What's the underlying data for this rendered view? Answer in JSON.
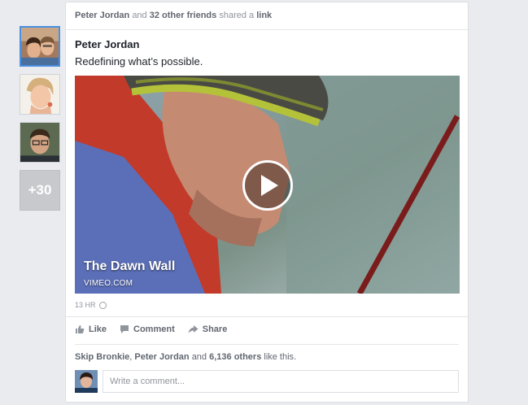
{
  "sidebar": {
    "more_count": "+30"
  },
  "story": {
    "header": {
      "actor": "Peter Jordan",
      "conj": "and",
      "friends": "32 other friends",
      "verb": "shared a",
      "object": "link"
    },
    "author": "Peter Jordan",
    "message": "Redefining what’s possible.",
    "video": {
      "title": "The Dawn Wall",
      "source": "VIMEO.COM"
    },
    "timestamp": "13 HR",
    "actions": {
      "like": "Like",
      "comment": "Comment",
      "share": "Share"
    },
    "likes": {
      "name1": "Skip Bronkie",
      "sep": ",",
      "name2": "Peter Jordan",
      "conj": "and",
      "others": "6,136 others",
      "tail": "like this."
    },
    "comment_placeholder": "Write a comment..."
  },
  "colors": {
    "accent": "#4a90e2",
    "background": "#e9ebee",
    "muted_text": "#90949c"
  }
}
